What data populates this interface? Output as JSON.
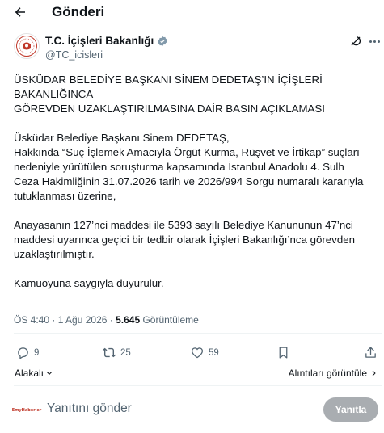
{
  "header": {
    "title": "Gönderi"
  },
  "author": {
    "name": "T.C. İçişleri Bakanlığı",
    "handle": "@TC_icisleri"
  },
  "post": {
    "lines": [
      "ÜSKÜDAR BELEDİYE BAŞKANI SİNEM DEDETAŞ’IN İÇİŞLERİ",
      "BAKANLIĞINCA",
      "GÖREVDEN UZAKLAŞTIRILMASINA DAİR BASIN AÇIKLAMASI",
      "",
      "Üsküdar Belediye Başkanı Sinem DEDETAŞ,",
      "Hakkında “Suç İşlemek Amacıyla Örgüt Kurma, Rüşvet ve İrtikap” suçları",
      "nedeniyle yürütülen soruşturma kapsamında İstanbul Anadolu 4. Sulh",
      "Ceza Hakimliğinin 31.07.2026 tarih ve 2026/994 Sorgu numaralı kararıyla",
      "tutuklanması üzerine,",
      "",
      "Anayasanın 127’nci maddesi ile 5393 sayılı Belediye Kanununun 47’nci",
      "maddesi uyarınca geçici bir tedbir olarak İçişleri Bakanlığı’nca görevden",
      "uzaklaştırılmıştır.",
      "",
      "Kamuoyuna saygıyla duyurulur."
    ]
  },
  "meta": {
    "time_date": "ÖS 4:40 · 1 Ağu 2026 · ",
    "views_count": "5.645",
    "views_label": " Görüntüleme"
  },
  "actions": {
    "replies": "9",
    "reposts": "25",
    "likes": "59"
  },
  "sort_label": "Alakalı",
  "quotes_label": "Alıntıları görüntüle",
  "reply": {
    "avatar_text": "EmyHaberler",
    "placeholder": "Yanıtını gönder",
    "button": "Yanıtla"
  },
  "colors": {
    "text": "#0f1419",
    "muted": "#536471",
    "verified": "#829aab",
    "disabled_button": "#a9adb1"
  },
  "icons": [
    "back-arrow-icon",
    "ministry-logo-icon",
    "verified-badge-icon",
    "grok-icon",
    "more-icon",
    "reply-icon",
    "repost-icon",
    "like-icon",
    "bookmark-icon",
    "share-icon",
    "chevron-down-icon",
    "chevron-right-icon"
  ]
}
